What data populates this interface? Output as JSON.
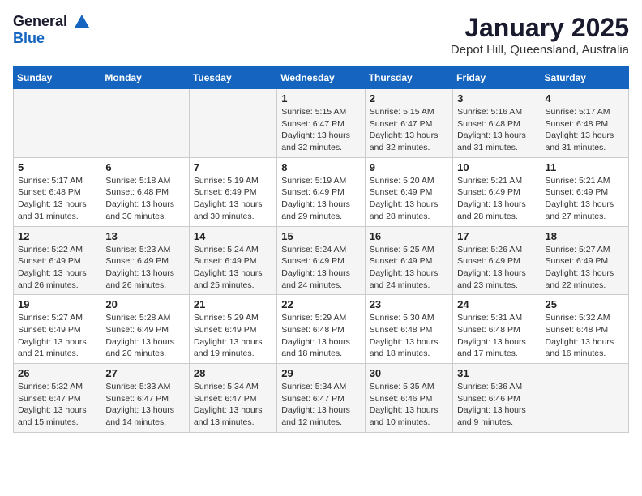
{
  "header": {
    "logo_line1": "General",
    "logo_line2": "Blue",
    "title": "January 2025",
    "subtitle": "Depot Hill, Queensland, Australia"
  },
  "days_of_week": [
    "Sunday",
    "Monday",
    "Tuesday",
    "Wednesday",
    "Thursday",
    "Friday",
    "Saturday"
  ],
  "weeks": [
    [
      {
        "day": "",
        "info": ""
      },
      {
        "day": "",
        "info": ""
      },
      {
        "day": "",
        "info": ""
      },
      {
        "day": "1",
        "info": "Sunrise: 5:15 AM\nSunset: 6:47 PM\nDaylight: 13 hours\nand 32 minutes."
      },
      {
        "day": "2",
        "info": "Sunrise: 5:15 AM\nSunset: 6:47 PM\nDaylight: 13 hours\nand 32 minutes."
      },
      {
        "day": "3",
        "info": "Sunrise: 5:16 AM\nSunset: 6:48 PM\nDaylight: 13 hours\nand 31 minutes."
      },
      {
        "day": "4",
        "info": "Sunrise: 5:17 AM\nSunset: 6:48 PM\nDaylight: 13 hours\nand 31 minutes."
      }
    ],
    [
      {
        "day": "5",
        "info": "Sunrise: 5:17 AM\nSunset: 6:48 PM\nDaylight: 13 hours\nand 31 minutes."
      },
      {
        "day": "6",
        "info": "Sunrise: 5:18 AM\nSunset: 6:48 PM\nDaylight: 13 hours\nand 30 minutes."
      },
      {
        "day": "7",
        "info": "Sunrise: 5:19 AM\nSunset: 6:49 PM\nDaylight: 13 hours\nand 30 minutes."
      },
      {
        "day": "8",
        "info": "Sunrise: 5:19 AM\nSunset: 6:49 PM\nDaylight: 13 hours\nand 29 minutes."
      },
      {
        "day": "9",
        "info": "Sunrise: 5:20 AM\nSunset: 6:49 PM\nDaylight: 13 hours\nand 28 minutes."
      },
      {
        "day": "10",
        "info": "Sunrise: 5:21 AM\nSunset: 6:49 PM\nDaylight: 13 hours\nand 28 minutes."
      },
      {
        "day": "11",
        "info": "Sunrise: 5:21 AM\nSunset: 6:49 PM\nDaylight: 13 hours\nand 27 minutes."
      }
    ],
    [
      {
        "day": "12",
        "info": "Sunrise: 5:22 AM\nSunset: 6:49 PM\nDaylight: 13 hours\nand 26 minutes."
      },
      {
        "day": "13",
        "info": "Sunrise: 5:23 AM\nSunset: 6:49 PM\nDaylight: 13 hours\nand 26 minutes."
      },
      {
        "day": "14",
        "info": "Sunrise: 5:24 AM\nSunset: 6:49 PM\nDaylight: 13 hours\nand 25 minutes."
      },
      {
        "day": "15",
        "info": "Sunrise: 5:24 AM\nSunset: 6:49 PM\nDaylight: 13 hours\nand 24 minutes."
      },
      {
        "day": "16",
        "info": "Sunrise: 5:25 AM\nSunset: 6:49 PM\nDaylight: 13 hours\nand 24 minutes."
      },
      {
        "day": "17",
        "info": "Sunrise: 5:26 AM\nSunset: 6:49 PM\nDaylight: 13 hours\nand 23 minutes."
      },
      {
        "day": "18",
        "info": "Sunrise: 5:27 AM\nSunset: 6:49 PM\nDaylight: 13 hours\nand 22 minutes."
      }
    ],
    [
      {
        "day": "19",
        "info": "Sunrise: 5:27 AM\nSunset: 6:49 PM\nDaylight: 13 hours\nand 21 minutes."
      },
      {
        "day": "20",
        "info": "Sunrise: 5:28 AM\nSunset: 6:49 PM\nDaylight: 13 hours\nand 20 minutes."
      },
      {
        "day": "21",
        "info": "Sunrise: 5:29 AM\nSunset: 6:49 PM\nDaylight: 13 hours\nand 19 minutes."
      },
      {
        "day": "22",
        "info": "Sunrise: 5:29 AM\nSunset: 6:48 PM\nDaylight: 13 hours\nand 18 minutes."
      },
      {
        "day": "23",
        "info": "Sunrise: 5:30 AM\nSunset: 6:48 PM\nDaylight: 13 hours\nand 18 minutes."
      },
      {
        "day": "24",
        "info": "Sunrise: 5:31 AM\nSunset: 6:48 PM\nDaylight: 13 hours\nand 17 minutes."
      },
      {
        "day": "25",
        "info": "Sunrise: 5:32 AM\nSunset: 6:48 PM\nDaylight: 13 hours\nand 16 minutes."
      }
    ],
    [
      {
        "day": "26",
        "info": "Sunrise: 5:32 AM\nSunset: 6:47 PM\nDaylight: 13 hours\nand 15 minutes."
      },
      {
        "day": "27",
        "info": "Sunrise: 5:33 AM\nSunset: 6:47 PM\nDaylight: 13 hours\nand 14 minutes."
      },
      {
        "day": "28",
        "info": "Sunrise: 5:34 AM\nSunset: 6:47 PM\nDaylight: 13 hours\nand 13 minutes."
      },
      {
        "day": "29",
        "info": "Sunrise: 5:34 AM\nSunset: 6:47 PM\nDaylight: 13 hours\nand 12 minutes."
      },
      {
        "day": "30",
        "info": "Sunrise: 5:35 AM\nSunset: 6:46 PM\nDaylight: 13 hours\nand 10 minutes."
      },
      {
        "day": "31",
        "info": "Sunrise: 5:36 AM\nSunset: 6:46 PM\nDaylight: 13 hours\nand 9 minutes."
      },
      {
        "day": "",
        "info": ""
      }
    ]
  ]
}
